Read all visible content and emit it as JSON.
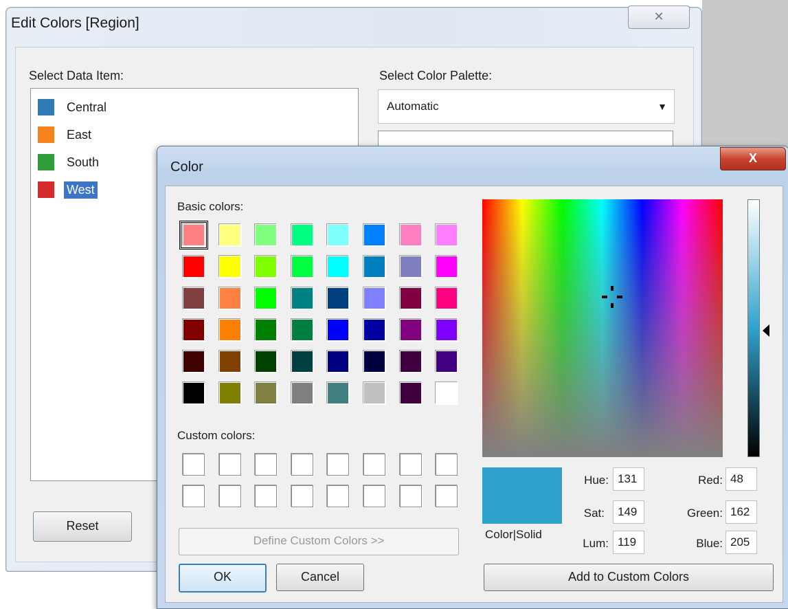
{
  "edit_colors": {
    "title": "Edit Colors [Region]",
    "close_glyph": "✕",
    "select_data_item_label": "Select Data Item:",
    "select_palette_label": "Select Color Palette:",
    "palette_value": "Automatic",
    "items": [
      {
        "label": "Central",
        "color": "#2f7ab4"
      },
      {
        "label": "East",
        "color": "#f7821b"
      },
      {
        "label": "South",
        "color": "#2f9e3a"
      },
      {
        "label": "West",
        "color": "#d62a2c"
      }
    ],
    "selected_item": "West",
    "reset_label": "Reset"
  },
  "color_dialog": {
    "title": "Color",
    "close_glyph": "X",
    "basic_colors_label": "Basic colors:",
    "custom_colors_label": "Custom colors:",
    "basic_colors": [
      "#ff8080",
      "#ffff80",
      "#80ff80",
      "#00ff80",
      "#80ffff",
      "#0080ff",
      "#ff80c0",
      "#ff80ff",
      "#ff0000",
      "#ffff00",
      "#80ff00",
      "#00ff40",
      "#00ffff",
      "#0080c0",
      "#8080c0",
      "#ff00ff",
      "#804040",
      "#ff8040",
      "#00ff00",
      "#008080",
      "#004080",
      "#8080ff",
      "#800040",
      "#ff0080",
      "#800000",
      "#ff8000",
      "#008000",
      "#008040",
      "#0000ff",
      "#0000a0",
      "#800080",
      "#8000ff",
      "#400000",
      "#804000",
      "#004000",
      "#004040",
      "#000080",
      "#000040",
      "#400040",
      "#400080",
      "#000000",
      "#808000",
      "#808040",
      "#808080",
      "#408080",
      "#c0c0c0",
      "#400040",
      "#ffffff"
    ],
    "custom_colors_count": 16,
    "define_custom_label": "Define Custom Colors >>",
    "ok_label": "OK",
    "cancel_label": "Cancel",
    "color_solid_label": "Color|Solid",
    "preview_color": "#30a2cd",
    "hue_label": "Hue:",
    "hue": "131",
    "sat_label": "Sat:",
    "sat": "149",
    "lum_label": "Lum:",
    "lum": "119",
    "red_label": "Red:",
    "red": "48",
    "green_label": "Green:",
    "green": "162",
    "blue_label": "Blue:",
    "blue": "205",
    "add_custom_label": "Add to Custom Colors"
  }
}
